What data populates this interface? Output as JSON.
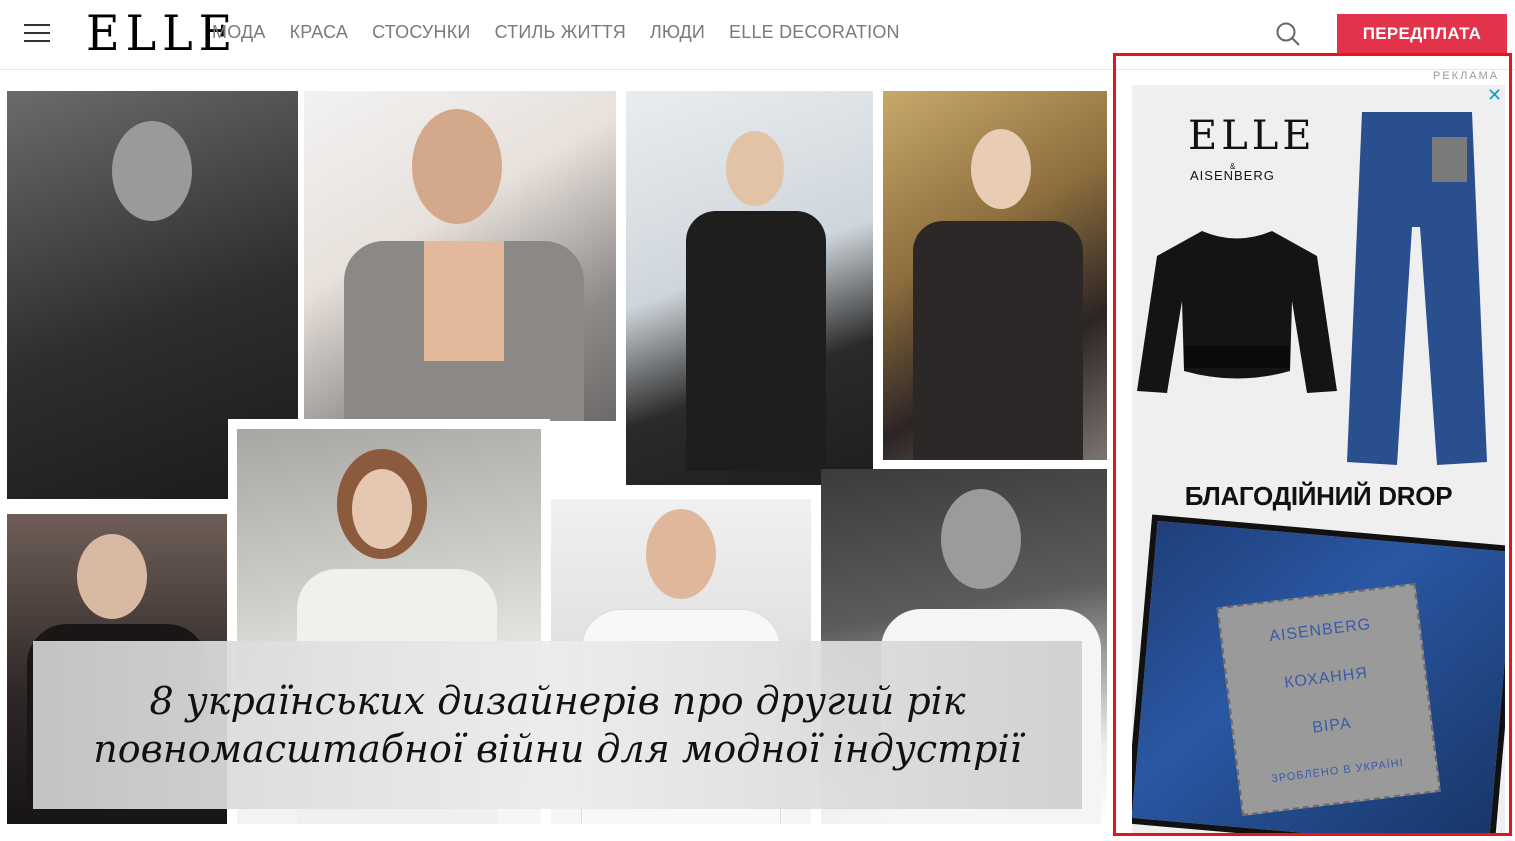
{
  "header": {
    "logo": "ELLE",
    "nav": [
      "МОДА",
      "КРАСА",
      "СТОСУНКИ",
      "СТИЛЬ ЖИТТЯ",
      "ЛЮДИ",
      "ELLE DECORATION"
    ],
    "subscribe_label": "ПЕРЕДПЛАТА",
    "icons": {
      "menu": "hamburger-menu-icon",
      "search": "search-icon"
    }
  },
  "hero": {
    "headline": "8 українських дизайнерів про другий рік повномасштабної війни для модної індустрії"
  },
  "ad": {
    "label": "РЕКЛАМА",
    "close": "✕",
    "logo": "ELLE",
    "amp": "&",
    "brand": "AISENBERG",
    "drop_text": "БЛАГОДІЙНИЙ DROP",
    "patch_lines": [
      "AISENBERG",
      "КОХАННЯ",
      "ВІРА",
      "ЗРОБЛЕНО В УКРАЇНІ"
    ]
  },
  "colors": {
    "accent": "#e3334b",
    "ad_outline": "#e5141f",
    "ad_close": "#00a0e4"
  }
}
